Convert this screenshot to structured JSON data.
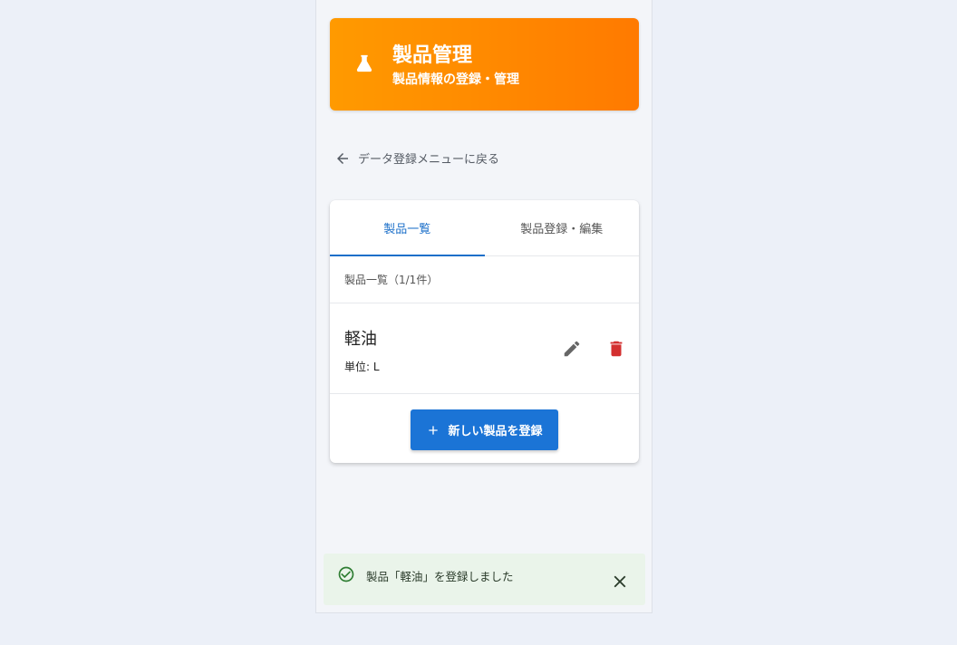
{
  "header": {
    "icon": "flask-icon",
    "title": "製品管理",
    "subtitle": "製品情報の登録・管理",
    "gradient_start": "#ff9a00",
    "gradient_end": "#ff7a00"
  },
  "back_link": {
    "icon": "arrow-left-icon",
    "label": "データ登録メニューに戻る"
  },
  "tabs": [
    {
      "label": "製品一覧",
      "active": true
    },
    {
      "label": "製品登録・編集",
      "active": false
    }
  ],
  "list": {
    "count_label": "製品一覧（1/1件）",
    "items": [
      {
        "name": "軽油",
        "unit": "単位: L",
        "edit_icon": "pencil-icon",
        "delete_icon": "trash-icon"
      }
    ]
  },
  "add_button": {
    "icon": "plus-icon",
    "label": "新しい製品を登録",
    "color": "#1b74d6"
  },
  "toast": {
    "icon": "check-circle-icon",
    "message": "製品「軽油」を登録しました",
    "close_icon": "close-icon"
  },
  "colors": {
    "accent": "#1b6fc9",
    "delete": "#d32f2f",
    "success": "#2e7d32"
  }
}
